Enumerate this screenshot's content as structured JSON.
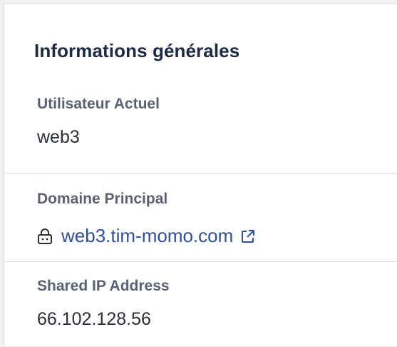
{
  "panel": {
    "title": "Informations générales"
  },
  "fields": {
    "current_user": {
      "label": "Utilisateur Actuel",
      "value": "web3"
    },
    "primary_domain": {
      "label": "Domaine Principal",
      "value": "web3.tim-momo.com",
      "icon": "lock-icon",
      "trailing_icon": "external-link-icon"
    },
    "shared_ip": {
      "label": "Shared IP Address",
      "value": "66.102.128.56"
    }
  },
  "colors": {
    "title": "#1d2a45",
    "label": "#5a6272",
    "value": "#2b2f36",
    "link": "#2f4ea3",
    "divider": "#d9dbdf"
  }
}
